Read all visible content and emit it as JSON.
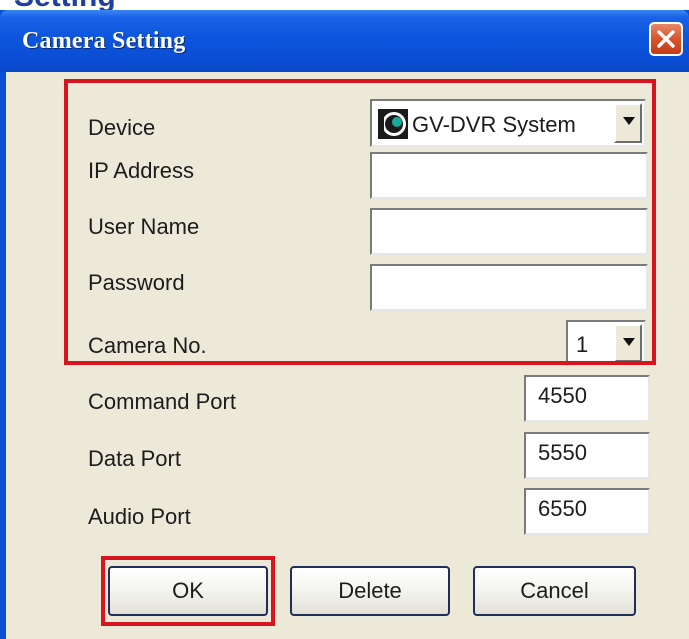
{
  "header_fragment": "Setting",
  "window": {
    "title": "Camera Setting"
  },
  "form": {
    "device": {
      "label": "Device",
      "value": "GV-DVR System",
      "icon": "geovision-icon"
    },
    "ip_address": {
      "label": "IP Address",
      "value": ""
    },
    "user_name": {
      "label": "User Name",
      "value": ""
    },
    "password": {
      "label": "Password",
      "value": ""
    },
    "camera_no": {
      "label": "Camera No.",
      "value": "1"
    },
    "command_port": {
      "label": "Command Port",
      "value": "4550"
    },
    "data_port": {
      "label": "Data Port",
      "value": "5550"
    },
    "audio_port": {
      "label": "Audio Port",
      "value": "6550"
    }
  },
  "buttons": {
    "ok": "OK",
    "delete": "Delete",
    "cancel": "Cancel"
  },
  "colors": {
    "titlebar": "#0a4fd6",
    "highlight": "#d8141e",
    "dialog_bg": "#ece9d8",
    "close_button": "#d8532c"
  }
}
